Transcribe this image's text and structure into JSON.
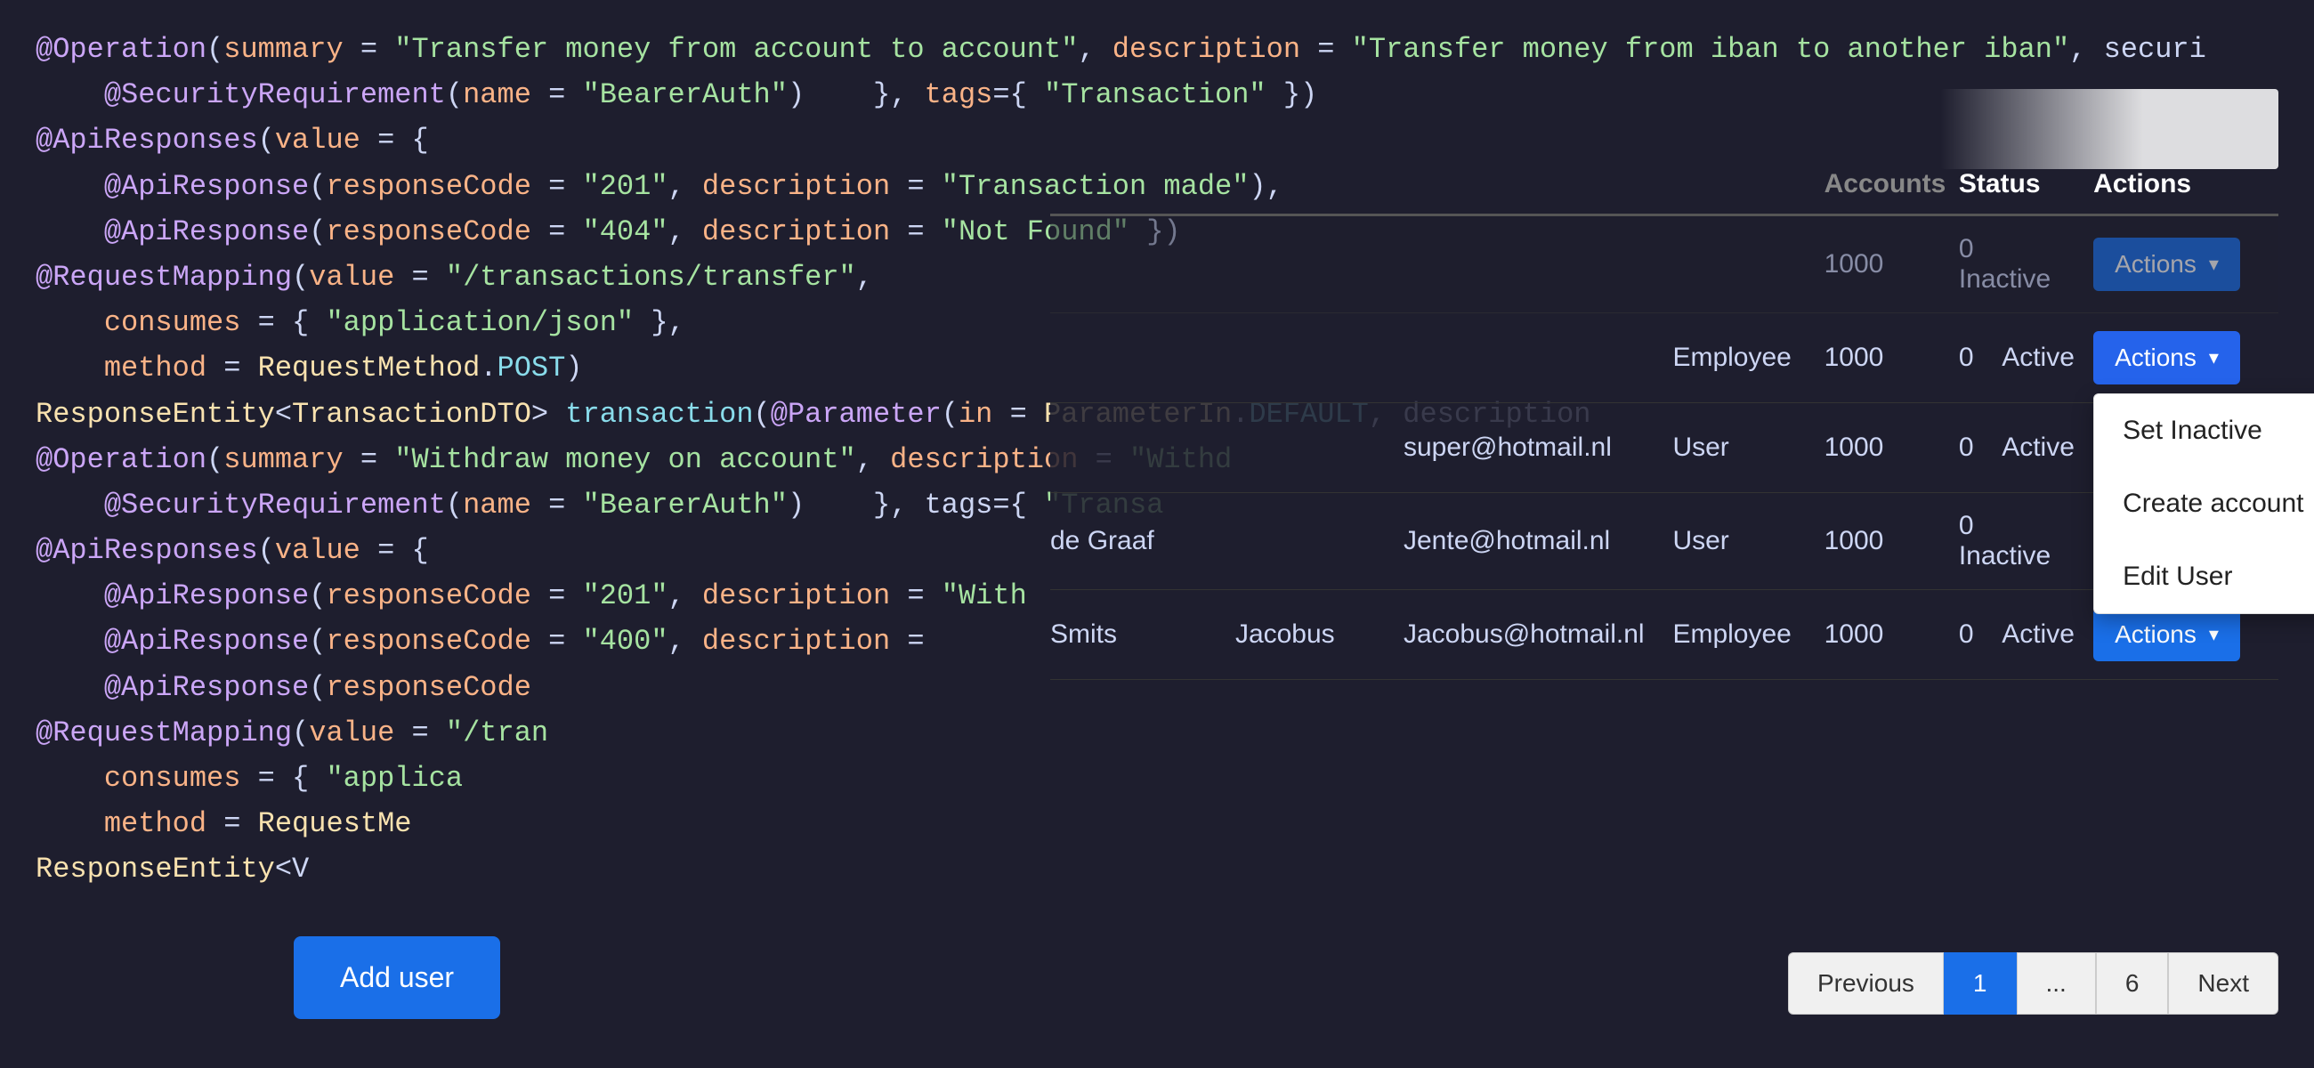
{
  "code": {
    "lines": [
      {
        "parts": [
          {
            "cls": "c-annotation",
            "text": "@Operation"
          },
          {
            "cls": "c-punct",
            "text": "("
          },
          {
            "cls": "c-param",
            "text": "summary"
          },
          {
            "cls": "c-punct",
            "text": " = "
          },
          {
            "cls": "c-string",
            "text": "\"Transfer money from account to account\""
          },
          {
            "cls": "c-punct",
            "text": ", "
          },
          {
            "cls": "c-param",
            "text": "description"
          },
          {
            "cls": "c-punct",
            "text": " = "
          },
          {
            "cls": "c-string",
            "text": "\"Transfer money from iban to another iban\""
          },
          {
            "cls": "c-punct",
            "text": ", securi"
          }
        ]
      },
      {
        "parts": [
          {
            "cls": "c-dim",
            "text": "    "
          },
          {
            "cls": "c-annotation",
            "text": "@SecurityRequirement"
          },
          {
            "cls": "c-punct",
            "text": "("
          },
          {
            "cls": "c-param",
            "text": "name"
          },
          {
            "cls": "c-punct",
            "text": " = "
          },
          {
            "cls": "c-string",
            "text": "\"BearerAuth\""
          },
          {
            "cls": "c-punct",
            "text": ") "
          },
          {
            "cls": "c-plain",
            "text": "   }, "
          },
          {
            "cls": "c-param",
            "text": "tags"
          },
          {
            "cls": "c-punct",
            "text": "={ "
          },
          {
            "cls": "c-string",
            "text": "\"Transaction\""
          },
          {
            "cls": "c-punct",
            "text": " })"
          }
        ]
      },
      {
        "parts": [
          {
            "cls": "c-annotation",
            "text": "@ApiResponses"
          },
          {
            "cls": "c-punct",
            "text": "("
          },
          {
            "cls": "c-param",
            "text": "value"
          },
          {
            "cls": "c-punct",
            "text": " = {"
          }
        ]
      },
      {
        "parts": [
          {
            "cls": "c-dim",
            "text": "    "
          },
          {
            "cls": "c-annotation",
            "text": "@ApiResponse"
          },
          {
            "cls": "c-punct",
            "text": "("
          },
          {
            "cls": "c-param",
            "text": "responseCode"
          },
          {
            "cls": "c-punct",
            "text": " = "
          },
          {
            "cls": "c-string",
            "text": "\"201\""
          },
          {
            "cls": "c-punct",
            "text": ", "
          },
          {
            "cls": "c-param",
            "text": "description"
          },
          {
            "cls": "c-punct",
            "text": " = "
          },
          {
            "cls": "c-string",
            "text": "\"Transaction made\""
          },
          {
            "cls": "c-punct",
            "text": "),"
          }
        ]
      },
      {
        "parts": [
          {
            "cls": "c-plain",
            "text": ""
          }
        ]
      },
      {
        "parts": [
          {
            "cls": "c-dim",
            "text": "    "
          },
          {
            "cls": "c-annotation",
            "text": "@ApiResponse"
          },
          {
            "cls": "c-punct",
            "text": "("
          },
          {
            "cls": "c-param",
            "text": "responseCode"
          },
          {
            "cls": "c-punct",
            "text": " = "
          },
          {
            "cls": "c-string",
            "text": "\"404\""
          },
          {
            "cls": "c-punct",
            "text": ", "
          },
          {
            "cls": "c-param",
            "text": "description"
          },
          {
            "cls": "c-punct",
            "text": " = "
          },
          {
            "cls": "c-string",
            "text": "\"Not Found\""
          },
          {
            "cls": "c-punct",
            "text": " })"
          }
        ]
      },
      {
        "parts": [
          {
            "cls": "c-annotation",
            "text": "@RequestMapping"
          },
          {
            "cls": "c-punct",
            "text": "("
          },
          {
            "cls": "c-param",
            "text": "value"
          },
          {
            "cls": "c-punct",
            "text": " = "
          },
          {
            "cls": "c-string",
            "text": "\"/transactions/transfer\""
          },
          {
            "cls": "c-punct",
            "text": ","
          }
        ]
      },
      {
        "parts": [
          {
            "cls": "c-dim",
            "text": "    "
          },
          {
            "cls": "c-param",
            "text": "consumes"
          },
          {
            "cls": "c-punct",
            "text": " = { "
          },
          {
            "cls": "c-string",
            "text": "\"application/json\""
          },
          {
            "cls": "c-punct",
            "text": " },"
          }
        ]
      },
      {
        "parts": [
          {
            "cls": "c-dim",
            "text": "    "
          },
          {
            "cls": "c-param",
            "text": "method"
          },
          {
            "cls": "c-punct",
            "text": " = "
          },
          {
            "cls": "c-class",
            "text": "RequestMethod"
          },
          {
            "cls": "c-punct",
            "text": "."
          },
          {
            "cls": "c-method",
            "text": "POST"
          },
          {
            "cls": "c-punct",
            "text": ")"
          }
        ]
      },
      {
        "parts": [
          {
            "cls": "c-class",
            "text": "ResponseEntity"
          },
          {
            "cls": "c-punct",
            "text": "<"
          },
          {
            "cls": "c-class",
            "text": "TransactionDTO"
          },
          {
            "cls": "c-punct",
            "text": "> "
          },
          {
            "cls": "c-method",
            "text": "transaction"
          },
          {
            "cls": "c-punct",
            "text": "("
          },
          {
            "cls": "c-annotation",
            "text": "@Parameter"
          },
          {
            "cls": "c-punct",
            "text": "("
          },
          {
            "cls": "c-param",
            "text": "in"
          },
          {
            "cls": "c-punct",
            "text": " = "
          },
          {
            "cls": "c-class",
            "text": "ParameterIn"
          },
          {
            "cls": "c-punct",
            "text": "."
          },
          {
            "cls": "c-method",
            "text": "DEFAULT"
          },
          {
            "cls": "c-punct",
            "text": ", description"
          }
        ]
      },
      {
        "parts": [
          {
            "cls": "c-plain",
            "text": ""
          }
        ]
      },
      {
        "parts": [
          {
            "cls": "c-annotation",
            "text": "@Operation"
          },
          {
            "cls": "c-punct",
            "text": "("
          },
          {
            "cls": "c-param",
            "text": "summary"
          },
          {
            "cls": "c-punct",
            "text": " = "
          },
          {
            "cls": "c-string",
            "text": "\"Withdraw money on account\""
          },
          {
            "cls": "c-punct",
            "text": ", "
          },
          {
            "cls": "c-param",
            "text": "description"
          },
          {
            "cls": "c-punct",
            "text": " = "
          },
          {
            "cls": "c-string",
            "text": "\"Withd"
          }
        ]
      },
      {
        "parts": [
          {
            "cls": "c-dim",
            "text": "    "
          },
          {
            "cls": "c-annotation",
            "text": "@SecurityRequirement"
          },
          {
            "cls": "c-punct",
            "text": "("
          },
          {
            "cls": "c-param",
            "text": "name"
          },
          {
            "cls": "c-punct",
            "text": " = "
          },
          {
            "cls": "c-string",
            "text": "\"BearerAuth\""
          },
          {
            "cls": "c-punct",
            "text": ") "
          },
          {
            "cls": "c-plain",
            "text": "   }, tags={ "
          },
          {
            "cls": "c-string",
            "text": "\"Transa"
          }
        ]
      },
      {
        "parts": [
          {
            "cls": "c-annotation",
            "text": "@ApiResponses"
          },
          {
            "cls": "c-punct",
            "text": "("
          },
          {
            "cls": "c-param",
            "text": "value"
          },
          {
            "cls": "c-punct",
            "text": " = {"
          }
        ]
      },
      {
        "parts": [
          {
            "cls": "c-dim",
            "text": "    "
          },
          {
            "cls": "c-annotation",
            "text": "@ApiResponse"
          },
          {
            "cls": "c-punct",
            "text": "("
          },
          {
            "cls": "c-param",
            "text": "responseCode"
          },
          {
            "cls": "c-punct",
            "text": " = "
          },
          {
            "cls": "c-string",
            "text": "\"201\""
          },
          {
            "cls": "c-punct",
            "text": ", "
          },
          {
            "cls": "c-param",
            "text": "description"
          },
          {
            "cls": "c-punct",
            "text": " = "
          },
          {
            "cls": "c-string",
            "text": "\"With"
          }
        ]
      },
      {
        "parts": [
          {
            "cls": "c-plain",
            "text": ""
          }
        ]
      },
      {
        "parts": [
          {
            "cls": "c-dim",
            "text": "    "
          },
          {
            "cls": "c-annotation",
            "text": "@ApiResponse"
          },
          {
            "cls": "c-punct",
            "text": "("
          },
          {
            "cls": "c-param",
            "text": "responseCode"
          },
          {
            "cls": "c-punct",
            "text": " = "
          },
          {
            "cls": "c-string",
            "text": "\"400\""
          },
          {
            "cls": "c-punct",
            "text": ", "
          },
          {
            "cls": "c-param",
            "text": "description"
          },
          {
            "cls": "c-punct",
            "text": " = "
          }
        ]
      },
      {
        "parts": [
          {
            "cls": "c-plain",
            "text": ""
          }
        ]
      },
      {
        "parts": [
          {
            "cls": "c-dim",
            "text": "    "
          },
          {
            "cls": "c-annotation",
            "text": "@ApiResponse"
          },
          {
            "cls": "c-punct",
            "text": "("
          },
          {
            "cls": "c-param",
            "text": "responseCode"
          }
        ]
      },
      {
        "parts": [
          {
            "cls": "c-annotation",
            "text": "@RequestMapping"
          },
          {
            "cls": "c-punct",
            "text": "("
          },
          {
            "cls": "c-param",
            "text": "value"
          },
          {
            "cls": "c-punct",
            "text": " = "
          },
          {
            "cls": "c-string",
            "text": "\"/tran"
          }
        ]
      },
      {
        "parts": [
          {
            "cls": "c-dim",
            "text": "    "
          },
          {
            "cls": "c-param",
            "text": "consumes"
          },
          {
            "cls": "c-punct",
            "text": " = { "
          },
          {
            "cls": "c-string",
            "text": "\"applica"
          }
        ]
      },
      {
        "parts": [
          {
            "cls": "c-dim",
            "text": "    "
          },
          {
            "cls": "c-param",
            "text": "method"
          },
          {
            "cls": "c-punct",
            "text": " = "
          },
          {
            "cls": "c-class",
            "text": "RequestMe"
          }
        ]
      },
      {
        "parts": [
          {
            "cls": "c-class",
            "text": "ResponseEntity"
          },
          {
            "cls": "c-punct",
            "text": "<V"
          }
        ]
      }
    ]
  },
  "table": {
    "headers": {
      "accounts": "Accounts",
      "status": "Status",
      "actions": "Actions"
    },
    "rows": [
      {
        "id": 1,
        "name": "",
        "firstname": "",
        "email": "",
        "role": "",
        "accounts": "1000",
        "status": "Inactive",
        "status_class": "status-inactive",
        "show_partial": true
      },
      {
        "id": 2,
        "name": "",
        "firstname": "",
        "email": "",
        "role": "Employee",
        "accounts": "1000",
        "balance": "0",
        "status": "Active",
        "status_class": "status-active",
        "dropdown_open": true
      },
      {
        "id": 3,
        "name": "",
        "firstname": "",
        "email": "super@hotmail.nl",
        "role": "User",
        "accounts": "1000",
        "balance": "0",
        "status": "Active",
        "status_class": "status-active"
      },
      {
        "id": 4,
        "name": "de Graaf",
        "firstname": "",
        "email": "Jente@hotmail.nl",
        "role": "User",
        "accounts": "1000",
        "balance": "0",
        "status": "Inactive",
        "status_class": "status-inactive"
      },
      {
        "id": 5,
        "name": "Smits",
        "firstname": "Jacobus",
        "email": "Jacobus@hotmail.nl",
        "role": "Employee",
        "accounts": "1000",
        "balance": "0",
        "status": "Active",
        "status_class": "status-active"
      }
    ],
    "dropdown": {
      "items": [
        "Set Inactive",
        "Create account",
        "Edit User"
      ]
    }
  },
  "pagination": {
    "previous_label": "Previous",
    "next_label": "Next",
    "current_page": "1",
    "ellipsis": "...",
    "last_page": "6"
  },
  "add_user": {
    "label": "Add user"
  },
  "actions_btn": {
    "label": "Actions"
  }
}
